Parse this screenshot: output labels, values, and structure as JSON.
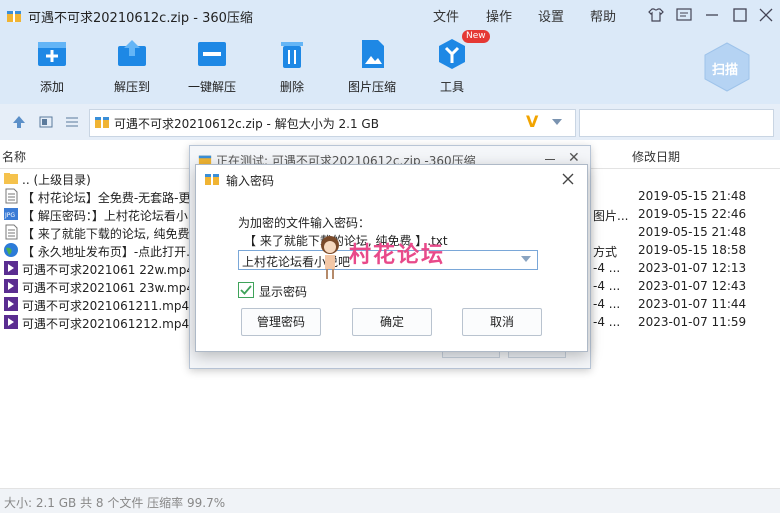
{
  "window": {
    "title": "可遇不可求20210612c.zip - 360压缩",
    "menu": [
      "文件",
      "操作",
      "设置",
      "帮助"
    ]
  },
  "toolbar": {
    "items": [
      {
        "label": "添加",
        "icon": "add-archive-icon"
      },
      {
        "label": "解压到",
        "icon": "extract-to-icon"
      },
      {
        "label": "一键解压",
        "icon": "one-click-extract-icon"
      },
      {
        "label": "删除",
        "icon": "trash-icon"
      },
      {
        "label": "图片压缩",
        "icon": "image-compress-icon"
      },
      {
        "label": "工具",
        "icon": "tools-icon",
        "badge": "New"
      }
    ],
    "scan_label": "扫描"
  },
  "addressbar": {
    "path": "可遇不可求20210612c.zip - 解包大小为 2.1 GB"
  },
  "filelist": {
    "columns": {
      "name": "名称",
      "modified": "修改日期"
    },
    "rows": [
      {
        "name": ".. (上级目录)",
        "extra": "",
        "date": "",
        "icon": "folder-up-icon"
      },
      {
        "name": "【 村花论坛】全免费-无套路-更",
        "extra": "",
        "date": "2019-05-15 21:48",
        "icon": "text-file-icon"
      },
      {
        "name": "【 解压密码：】上村花论坛看小",
        "extra": "图片...",
        "date": "2019-05-15 22:46",
        "icon": "jpg-file-icon"
      },
      {
        "name": "【 来了就能下载的论坛, 纯免费",
        "extra": "",
        "date": "2019-05-15 21:48",
        "icon": "text-file-icon"
      },
      {
        "name": "【 永久地址发布页】-点此打开.",
        "extra": "方式",
        "date": "2019-05-15 18:58",
        "icon": "web-link-icon"
      },
      {
        "name": "可遇不可求2021061 22w.mp4 *",
        "extra": "-4 ...",
        "date": "2023-01-07 12:13",
        "icon": "mp4-file-icon"
      },
      {
        "name": "可遇不可求2021061 23w.mp4 *",
        "extra": "-4 ...",
        "date": "2023-01-07 12:43",
        "icon": "mp4-file-icon"
      },
      {
        "name": "可遇不可求2021061211.mp4 *",
        "extra": "-4 ...",
        "date": "2023-01-07 11:44",
        "icon": "mp4-file-icon"
      },
      {
        "name": "可遇不可求2021061212.mp4 *",
        "extra": "-4 ...",
        "date": "2023-01-07 11:59",
        "icon": "mp4-file-icon"
      }
    ]
  },
  "status": "大小: 2.1 GB 共 8 个文件 压缩率 99.7%",
  "test_dialog": {
    "title": "正在测试: 可遇不可求20210612c.zip -360压缩"
  },
  "password_dialog": {
    "title": "输入密码",
    "prompt": "为加密的文件输入密码：",
    "filename": "【 来了就能下载的论坛, 纯免费 】.txt",
    "password_value": "上村花论坛看小说吧",
    "show_password_label": "显示密码",
    "show_password_checked": true,
    "buttons": {
      "manage": "管理密码",
      "ok": "确定",
      "cancel": "取消"
    }
  },
  "watermark": "村花论坛",
  "colors": {
    "accent": "#1e88e5",
    "new_badge": "#e53935",
    "watermark": "#e84a8a"
  }
}
